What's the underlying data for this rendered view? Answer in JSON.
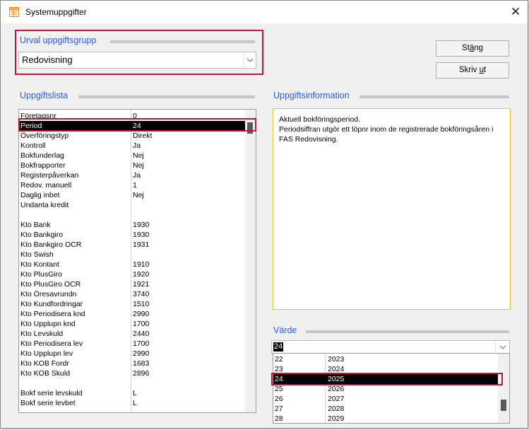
{
  "window": {
    "title": "Systemuppgifter",
    "close_glyph": "✕"
  },
  "group_select": {
    "title": "Urval uppgiftsgrupp",
    "value": "Redovisning"
  },
  "buttons": {
    "close_prefix": "St",
    "close_underlined": "ä",
    "close_suffix": "ng",
    "print_prefix": "Skriv ",
    "print_underlined": "u",
    "print_suffix": "t"
  },
  "task_list": {
    "title": "Uppgiftslista",
    "selected_index": 1,
    "rows": [
      [
        "Företagsnr",
        "0"
      ],
      [
        "Period",
        "24"
      ],
      [
        "Överföringstyp",
        "Direkt"
      ],
      [
        "Kontroll",
        "Ja"
      ],
      [
        "Bokfunderlag",
        "Nej"
      ],
      [
        "Bokfrapporter",
        "Nej"
      ],
      [
        "Registerpåverkan",
        "Ja"
      ],
      [
        "Redov. manuell",
        "1"
      ],
      [
        "Daglig inbet",
        "Nej"
      ],
      [
        "Undanta kredit",
        ""
      ],
      [
        "",
        ""
      ],
      [
        "Kto Bank",
        "1930"
      ],
      [
        "Kto Bankgiro",
        "1930"
      ],
      [
        "Kto Bankgiro OCR",
        "1931"
      ],
      [
        "Kto Swish",
        ""
      ],
      [
        "Kto Kontant",
        "1910"
      ],
      [
        "Kto PlusGiro",
        "1920"
      ],
      [
        "Kto PlusGiro OCR",
        "1921"
      ],
      [
        "Kto Öresavrundn",
        "3740"
      ],
      [
        "Kto Kundfordringar",
        "1510"
      ],
      [
        "Kto Periodisera knd",
        "2990"
      ],
      [
        "Kto Upplupn knd",
        "1700"
      ],
      [
        "Kto Levskuld",
        "2440"
      ],
      [
        "Kto Periodisera lev",
        "1700"
      ],
      [
        "Kto Upplupn lev",
        "2990"
      ],
      [
        "Kto KOB Fordr",
        "1683"
      ],
      [
        "Kto KOB Skuld",
        "2896"
      ],
      [
        "",
        ""
      ],
      [
        "Bokf serie levskuld",
        "L"
      ],
      [
        "Bokf serie levbet",
        "L"
      ]
    ]
  },
  "task_info": {
    "title": "Uppgiftsinformation",
    "line1": "Aktuell bokföringsperiod.",
    "line2": "Periodsiffran utgör ett löpnr inom de registrerade bokföringsåren i",
    "line3": "FAS Redovisning."
  },
  "value_select": {
    "title": "Värde",
    "current": "24",
    "selected_index": 2,
    "rows": [
      [
        "22",
        "2023"
      ],
      [
        "23",
        "2024"
      ],
      [
        "24",
        "2025"
      ],
      [
        "25",
        "2026"
      ],
      [
        "26",
        "2027"
      ],
      [
        "27",
        "2028"
      ],
      [
        "28",
        "2029"
      ]
    ]
  },
  "colors": {
    "accent_title": "#2a5fd0",
    "highlight_frame": "#c0143c",
    "info_border": "#f0c020",
    "selection": "#000000"
  },
  "icons": {
    "app": "table-window-icon",
    "close": "close-icon",
    "dropdown": "chevron-down-icon"
  }
}
